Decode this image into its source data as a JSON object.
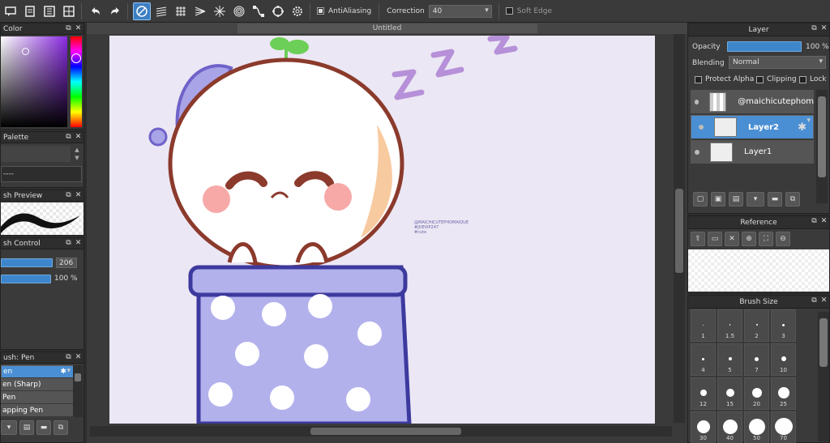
{
  "toolbar": {
    "antialiasing_label": "AntiAliasing",
    "correction_label": "Correction",
    "correction_value": "40",
    "soft_edge_label": "Soft Edge",
    "antialiasing_checked": true,
    "soft_edge_checked": false
  },
  "panels": {
    "color": {
      "title": "Color"
    },
    "palette": {
      "title": "Palette",
      "value": "----"
    },
    "brush_preview": {
      "title": "sh Preview"
    },
    "brush_control": {
      "title": "sh Control",
      "size_value": "206",
      "opacity_value": "100 %"
    },
    "brush_list": {
      "title": "ush: Pen",
      "items": [
        "en",
        "en (Sharp)",
        "Pen",
        "apping Pen"
      ],
      "selected_index": 0
    }
  },
  "document": {
    "tab_title": "Untitled",
    "watermark_lines": [
      "@MAICHICUTEPHOMAIQUE",
      "#JOEVIP247",
      "#cute"
    ]
  },
  "layer_panel": {
    "title": "Layer",
    "opacity_label": "Opacity",
    "opacity_value": "100 %",
    "blending_label": "Blending",
    "blending_value": "Normal",
    "protect_alpha_label": "Protect Alpha",
    "clipping_label": "Clipping",
    "lock_label": "Lock",
    "layers": [
      {
        "name": "@maichicutephom"
      },
      {
        "name": "Layer2"
      },
      {
        "name": "Layer1"
      }
    ],
    "selected_index": 1
  },
  "reference_panel": {
    "title": "Reference"
  },
  "brush_size_panel": {
    "title": "Brush Size",
    "sizes": [
      "1",
      "1.5",
      "2",
      "3",
      "4",
      "5",
      "7",
      "10",
      "12",
      "15",
      "20",
      "25",
      "30",
      "40",
      "50",
      "70"
    ]
  },
  "colors": {
    "accent": "#4a8fd3",
    "panel_bg": "#3a3a3a",
    "canvas_bg": "#ece7f4"
  }
}
